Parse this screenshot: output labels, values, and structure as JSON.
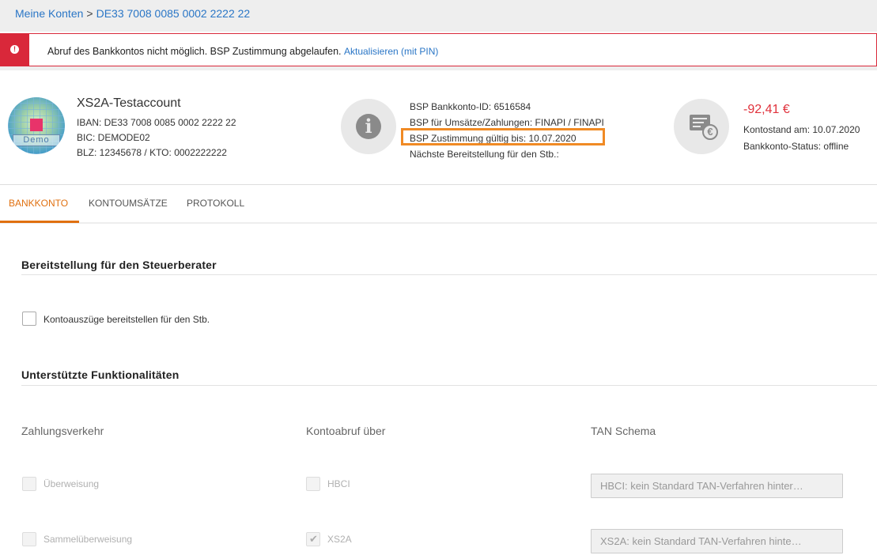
{
  "breadcrumb": {
    "root": "Meine Konten",
    "separator": ">",
    "current": "DE33 7008 0085 0002 2222 22"
  },
  "alert": {
    "icon": "exclamation-icon",
    "message": "Abruf des Bankkontos nicht möglich. BSP Zustimmung abgelaufen.",
    "action_link": "Aktualisieren (mit PIN)",
    "color": "#d9283a"
  },
  "account": {
    "avatar_label": "Demo",
    "name": "XS2A-Testaccount",
    "iban": "IBAN: DE33 7008 0085 0002 2222 22",
    "bic": "BIC: DEMODE02",
    "blz": "BLZ: 12345678 / KTO: 0002222222"
  },
  "bsp": {
    "icon": "info-icon",
    "bankkonto_id": "BSP Bankkonto-ID: 6516584",
    "umsaetze": "BSP für Umsätze/Zahlungen: FINAPI / FINAPI",
    "zustimmung": "BSP Zustimmung gültig bis: 10.07.2020",
    "bereitstellung": "Nächste Bereitstellung für den Stb.:",
    "highlight_color": "#f08a24"
  },
  "balance": {
    "icon": "bank-statement-euro-icon",
    "amount": "-92,41 €",
    "kontostand": "Kontostand am: 10.07.2020",
    "status": "Bankkonto-Status: offline",
    "amount_color": "#e0323c"
  },
  "tabs": [
    {
      "label": "BANKKONTO",
      "active": true
    },
    {
      "label": "KONTOUMSÄTZE",
      "active": false
    },
    {
      "label": "PROTOKOLL",
      "active": false
    }
  ],
  "sections": {
    "bereitstellung": {
      "title": "Bereitstellung für den Steuerberater",
      "checkbox_label": "Kontoauszüge bereitstellen für den Stb.",
      "checked": false
    },
    "funktionen": {
      "title": "Unterstützte Funktionalitäten",
      "columns": [
        "Zahlungsverkehr",
        "Kontoabruf über",
        "TAN Schema"
      ],
      "rows": [
        {
          "payment_label": "Überweisung",
          "payment_checked": false,
          "access_label": "HBCI",
          "access_checked": false,
          "tan_value": "HBCI: kein Standard TAN-Verfahren hinter…"
        },
        {
          "payment_label": "Sammelüberweisung",
          "payment_checked": false,
          "access_label": "XS2A",
          "access_checked": true,
          "tan_value": "XS2A: kein Standard TAN-Verfahren hinte…"
        }
      ]
    }
  },
  "accent_color": "#e07010"
}
